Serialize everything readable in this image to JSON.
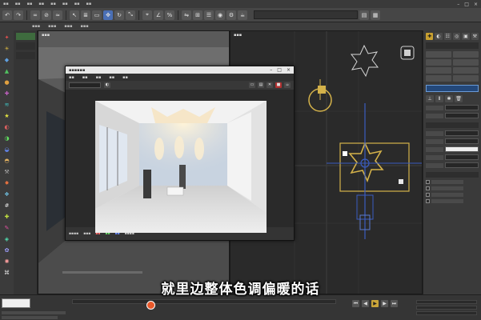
{
  "subtitle": "就里边整体色调偏暖的话",
  "colors": {
    "accent_yellow": "#c8a030",
    "selection_blue": "#23487a",
    "gizmo_yellow": "#d4b24a",
    "gizmo_blue": "#3a5cc0"
  },
  "icons": {
    "close": "close-icon",
    "minimize": "minimize-icon",
    "maximize": "maximize-icon",
    "star_light": "star-light-icon",
    "sun": "sun-icon",
    "app_logo": "app-logo-icon"
  }
}
